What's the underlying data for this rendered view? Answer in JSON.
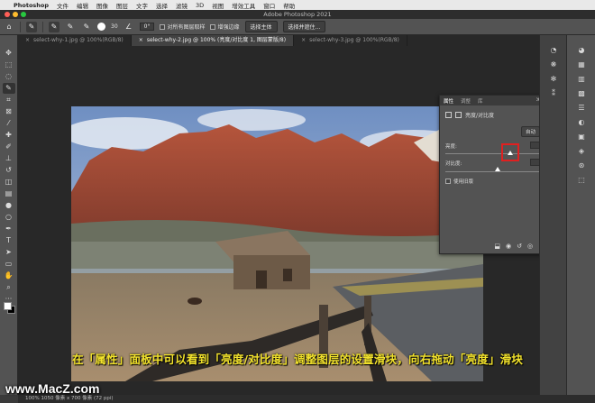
{
  "menubar": {
    "app": "Photoshop",
    "items": [
      "文件",
      "编辑",
      "图像",
      "图层",
      "文字",
      "选择",
      "滤镜",
      "3D",
      "视图",
      "增效工具",
      "窗口",
      "帮助"
    ]
  },
  "window": {
    "title": "Adobe Photoshop 2021"
  },
  "options_bar": {
    "brush_size": "30",
    "angle": "0°",
    "sample_all_layers": "对所有图层取样",
    "enhance_edge": "增强边缘",
    "select_subject": "选择主体",
    "select_and_mask": "选择并遮住..."
  },
  "tabs": [
    {
      "label": "select-why-1.jpg @ 100%(RGB/8)",
      "active": false
    },
    {
      "label": "select-why-2.jpg @ 100% (亮度/对比度 1, 图层蒙版/8)",
      "active": true
    },
    {
      "label": "select-why-3.jpg @ 100%(RGB/8)",
      "active": false
    }
  ],
  "properties_panel": {
    "tabs": [
      "属性",
      "调整",
      "库"
    ],
    "header": "亮度/对比度",
    "auto_button": "自动",
    "brightness_label": "亮度:",
    "brightness_value": "35",
    "contrast_label": "对比度:",
    "contrast_value": "0",
    "legacy_label": "使用旧版"
  },
  "statusbar": {
    "text": "100%    1050 像素 x 700 像素 (72 ppi)"
  },
  "caption": "在「属性」面板中可以看到「亮度/对比度」调整图层的设置滑块，向右拖动「亮度」滑块",
  "watermark": "www.MacZ.com",
  "colors": {
    "caption": "#f2e22c",
    "highlight": "#e02020"
  }
}
